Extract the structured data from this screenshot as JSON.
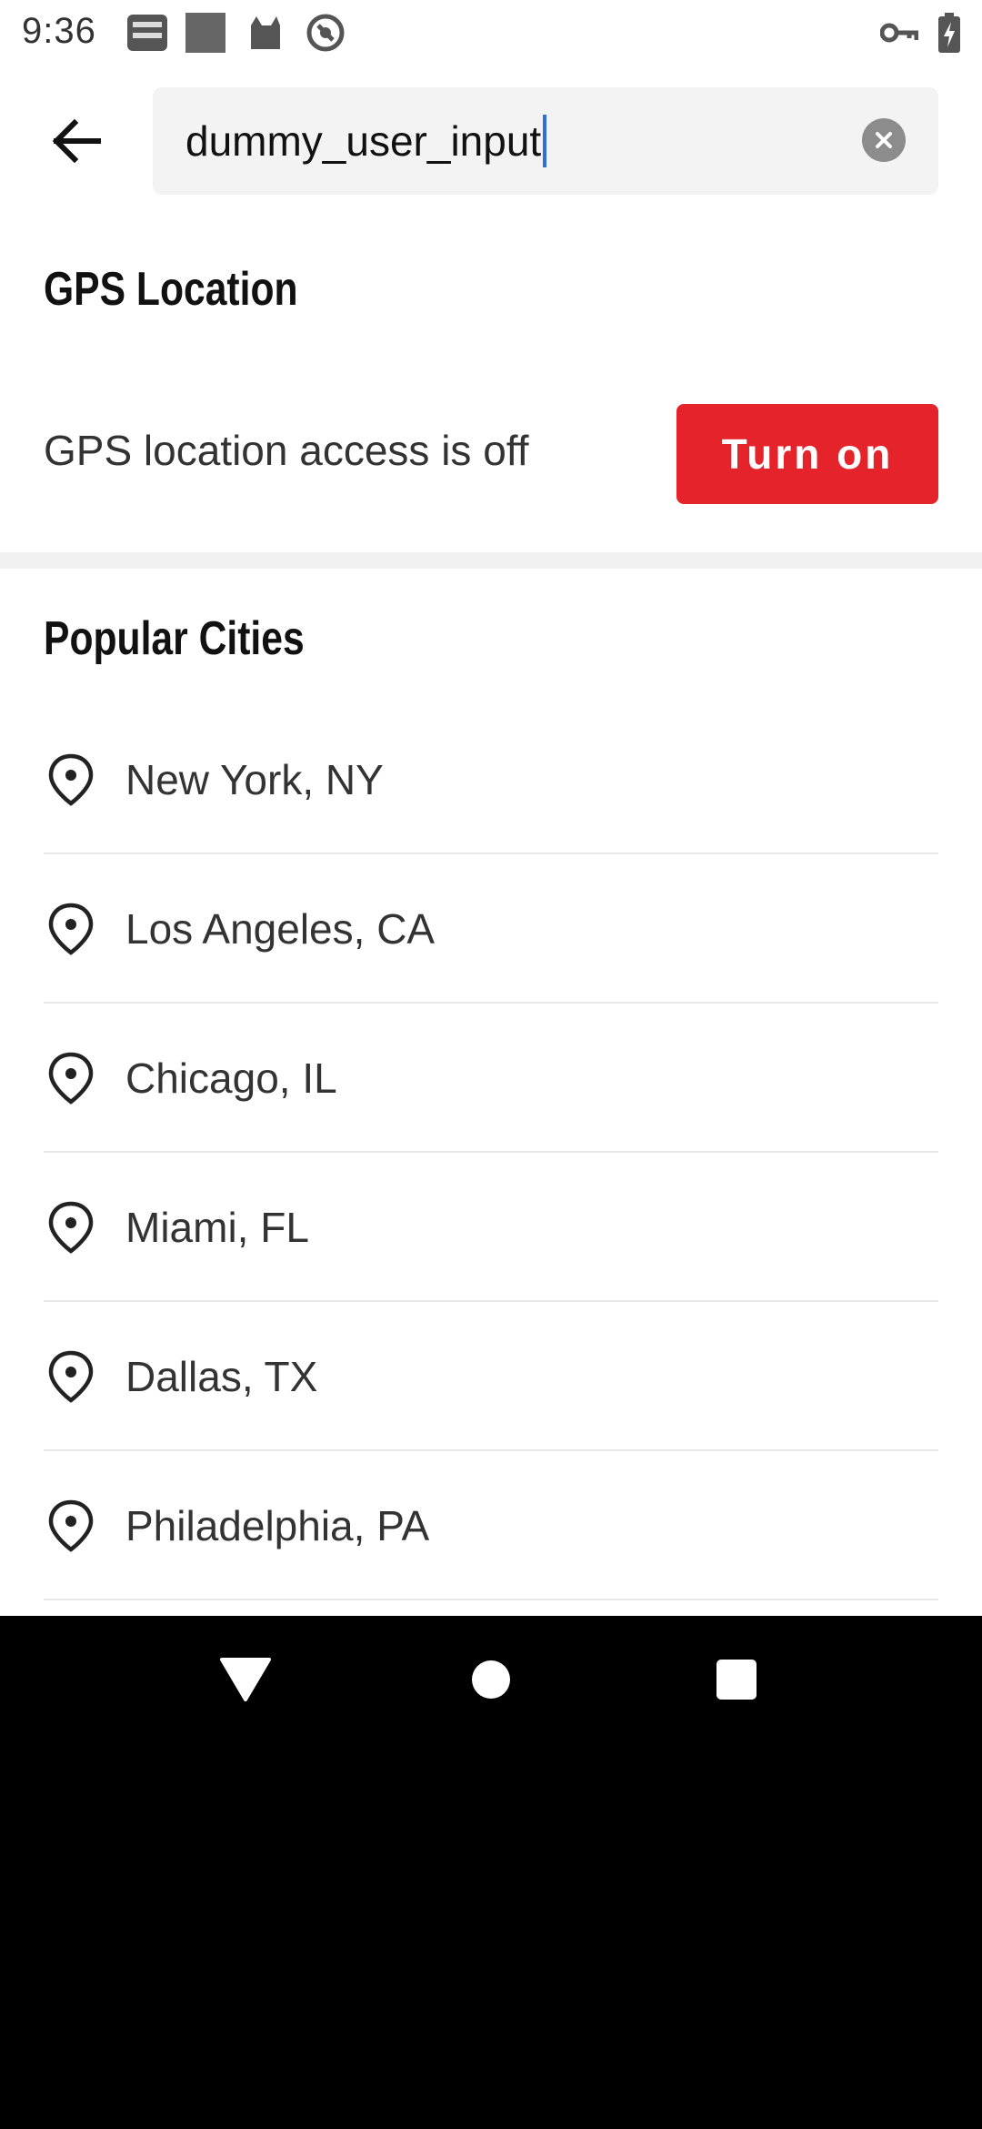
{
  "status_bar": {
    "time": "9:36",
    "left_icons": [
      "news-radar-icon",
      "square-notification-icon",
      "cat-icon",
      "no-sync-icon"
    ],
    "right_icons": [
      "vpn-key-icon",
      "battery-charging-icon"
    ]
  },
  "search": {
    "value": "dummy_user_input",
    "back_icon": "back-arrow-icon",
    "clear_icon": "clear-icon"
  },
  "gps_section": {
    "title": "GPS Location",
    "status_text": "GPS location access is off",
    "button_label": "Turn on",
    "button_color": "#e5232b"
  },
  "popular_section": {
    "title": "Popular Cities",
    "item_icon": "location-pin-icon",
    "cities": [
      "New York, NY",
      "Los Angeles, CA",
      "Chicago, IL",
      "Miami, FL",
      "Dallas, TX",
      "Philadelphia, PA"
    ]
  },
  "nav_bar": {
    "icons": [
      "back-triangle-icon",
      "home-circle-icon",
      "recents-square-icon"
    ]
  }
}
